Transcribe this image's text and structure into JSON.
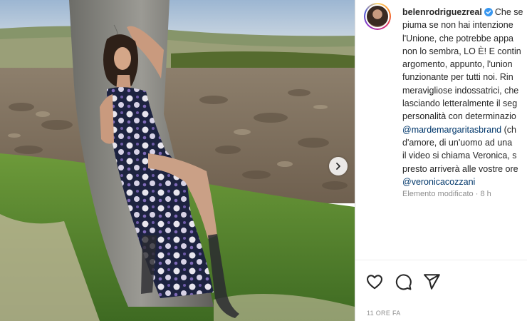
{
  "post": {
    "username": "belenrodriguezreal",
    "caption_lines": [
      {
        "text": "Che se",
        "kind": "first"
      },
      {
        "text": "piuma se non hai intenzione",
        "kind": "text"
      },
      {
        "text": "l'Unione, che potrebbe appa",
        "kind": "text"
      },
      {
        "text": "non lo sembra, LO È! E contin",
        "kind": "text"
      },
      {
        "text": "argomento, appunto, l'union",
        "kind": "text"
      },
      {
        "text": "funzionante per tutti noi. Rin",
        "kind": "text"
      },
      {
        "text": "meravigliose indossatrici, che",
        "kind": "text"
      },
      {
        "text": "lasciando letteralmente il seg",
        "kind": "text"
      },
      {
        "text": "personalità con determinazio",
        "kind": "text"
      },
      {
        "text": "@mardemargaritasbrand",
        "tail": " (ch",
        "kind": "mention"
      },
      {
        "text": "d'amore, di un'uomo ad una",
        "kind": "text"
      },
      {
        "text": "il video si chiama Veronica, s",
        "kind": "text"
      },
      {
        "text": "presto arriverà alle vostre ore",
        "kind": "text"
      },
      {
        "text": "@veronicacozzani",
        "kind": "mention"
      }
    ],
    "edited_label": "Elemento modificato",
    "edited_time": "8 h",
    "timestamp": "11 ORE FA"
  },
  "icons": {
    "like": "heart-icon",
    "comment": "comment-icon",
    "share": "share-icon",
    "next": "chevron-right-icon",
    "verified": "verified-badge-icon"
  },
  "colors": {
    "text": "#262626",
    "secondary": "#8e8e8e",
    "mention": "#00376b",
    "verified": "#3897f0",
    "border": "#dbdbdb"
  }
}
